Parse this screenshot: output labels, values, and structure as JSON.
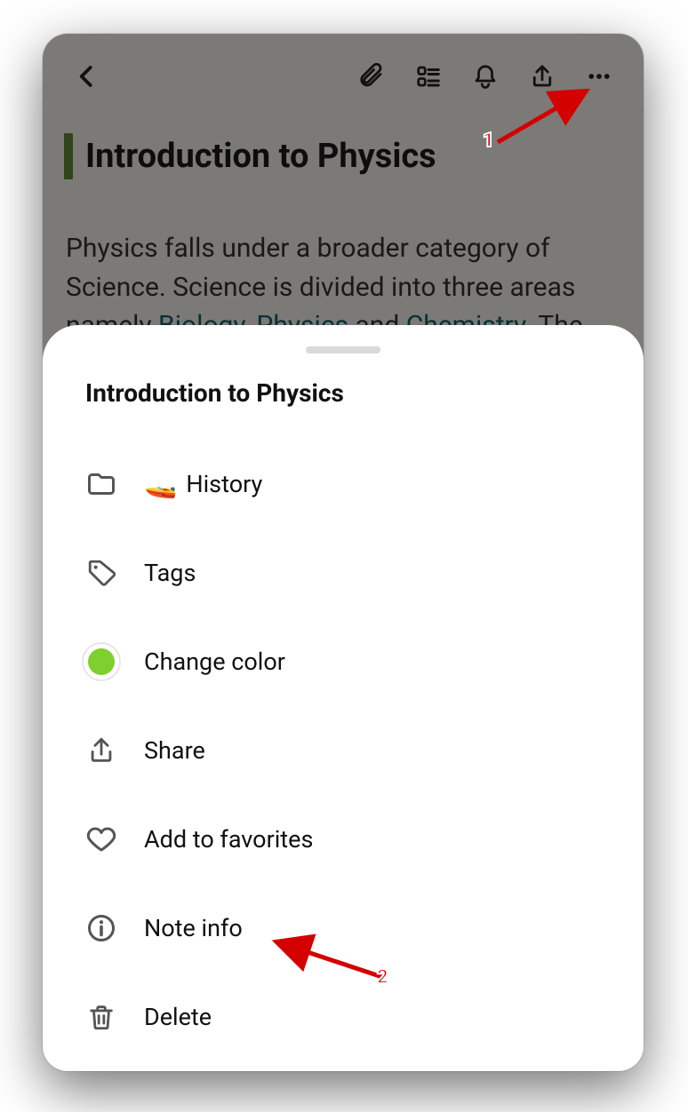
{
  "note": {
    "title": "Introduction to Physics",
    "body_prefix": "Physics falls under a broader category of Science. Science is divided into three areas namely ",
    "link_biology": "Biology",
    "sep_1": ", ",
    "link_physics": "Physics",
    "sep_2": " and ",
    "link_chemistry": "Chemistry",
    "body_suffix": ". The"
  },
  "toolbar": {
    "back": "Back",
    "attachment": "Attachment",
    "checklist": "Checklist",
    "reminder": "Reminder",
    "share": "Share",
    "more": "More"
  },
  "sheet": {
    "title": "Introduction to Physics",
    "items": [
      {
        "key": "folder",
        "label": "History",
        "emoji": "🚤"
      },
      {
        "key": "tags",
        "label": "Tags"
      },
      {
        "key": "color",
        "label": "Change color",
        "color": "#7fcf2e"
      },
      {
        "key": "share",
        "label": "Share"
      },
      {
        "key": "favorite",
        "label": "Add to favorites"
      },
      {
        "key": "info",
        "label": "Note info"
      },
      {
        "key": "delete",
        "label": "Delete"
      }
    ]
  },
  "annotations": {
    "step1": "1",
    "step2": "2"
  }
}
